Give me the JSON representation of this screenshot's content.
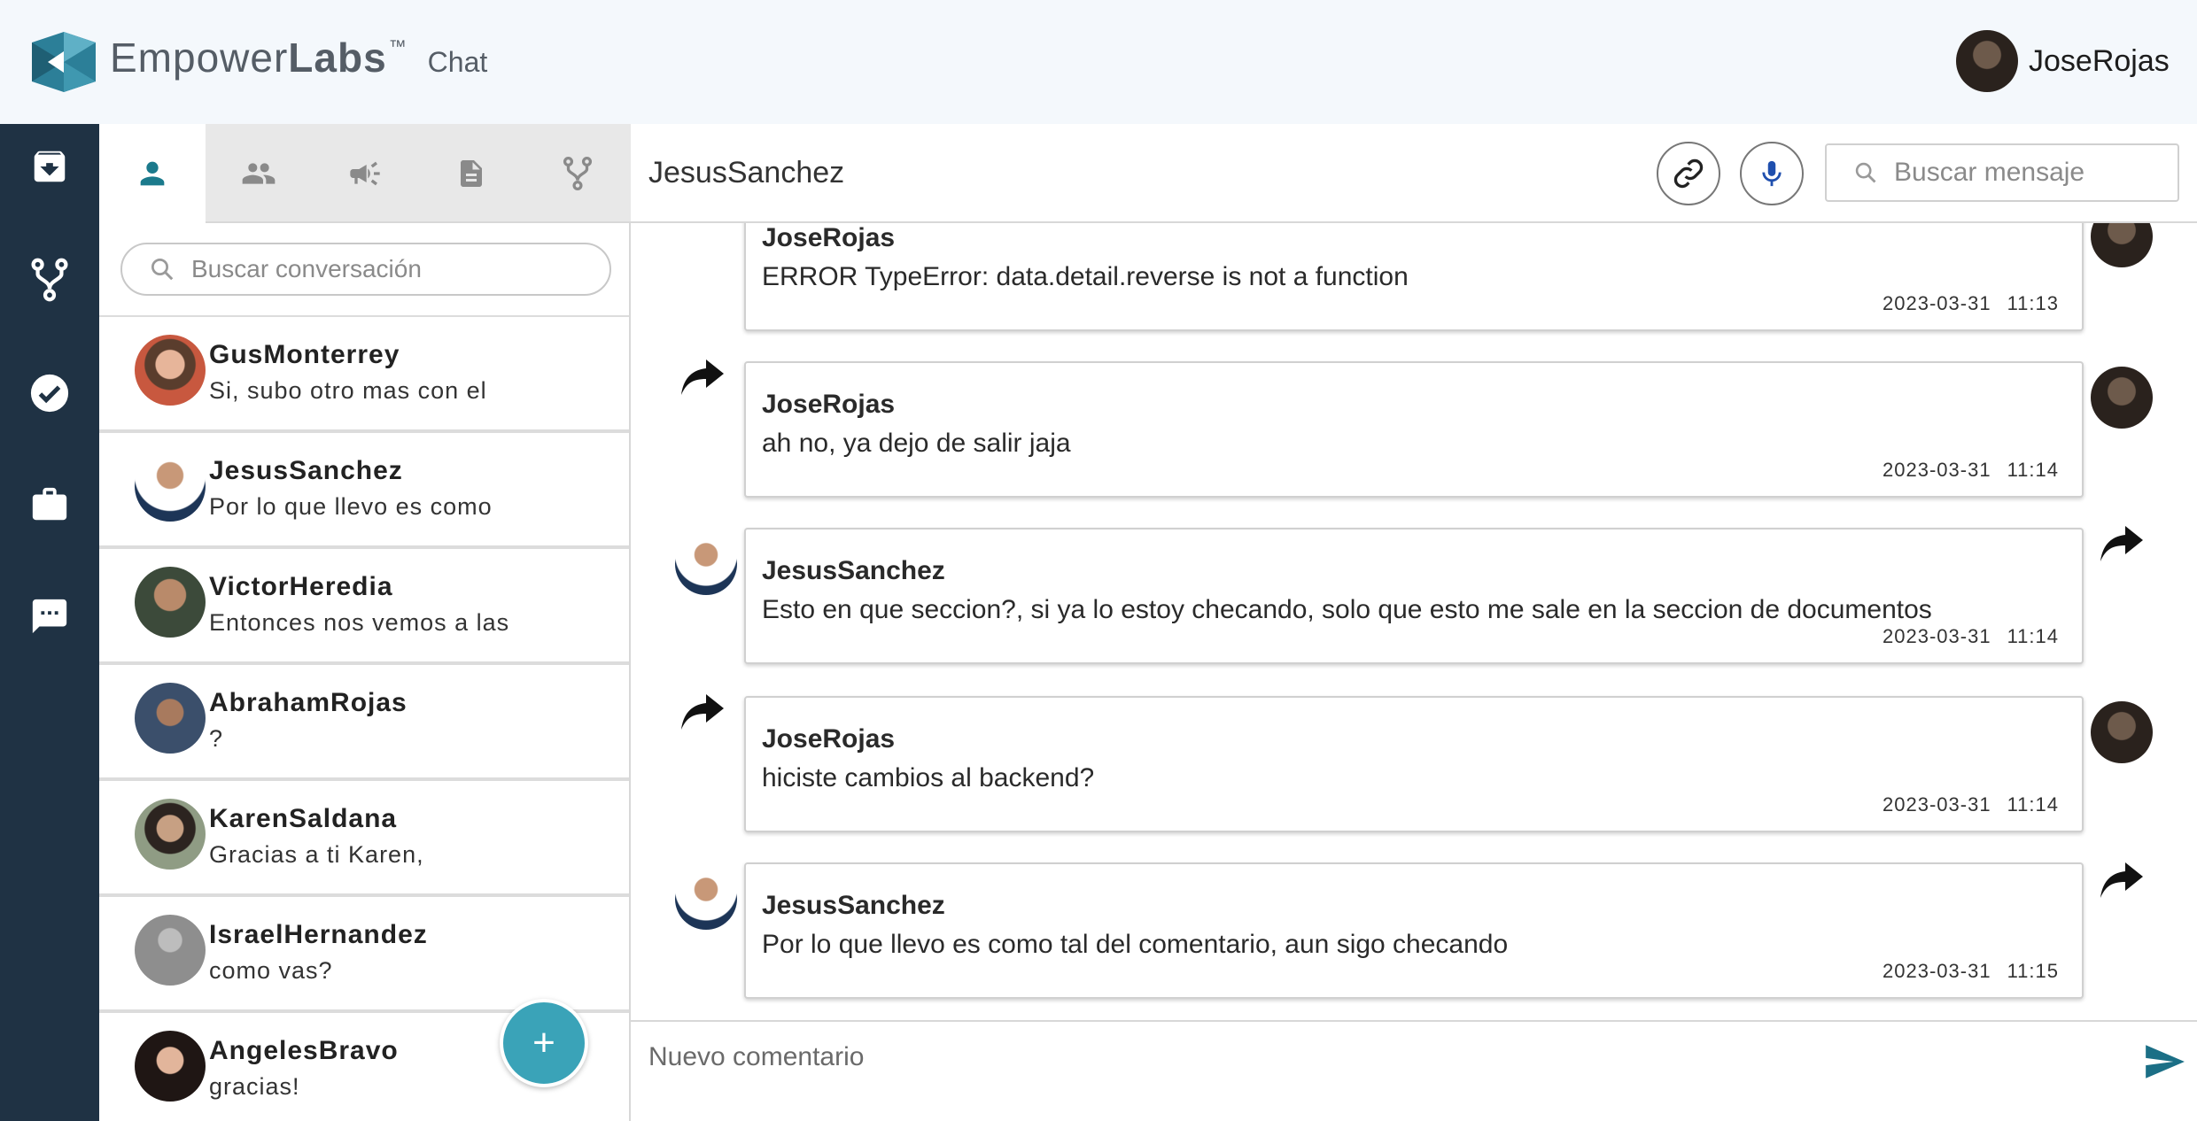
{
  "app": {
    "brand_first": "Empower",
    "brand_second": "Labs",
    "brand_tm": "™",
    "brand_suffix": "Chat",
    "accent_color": "#3aa3b8",
    "rail_color": "#1f3244"
  },
  "user": {
    "name": "JoseRojas"
  },
  "rail": {
    "items": [
      {
        "icon": "archive-download-icon"
      },
      {
        "icon": "fork-branch-icon"
      },
      {
        "icon": "check-circle-icon"
      },
      {
        "icon": "briefcase-icon"
      },
      {
        "icon": "chat-bubble-icon"
      }
    ]
  },
  "tabs": [
    {
      "icon": "person-icon",
      "active": true
    },
    {
      "icon": "group-icon",
      "active": false
    },
    {
      "icon": "megaphone-icon",
      "active": false
    },
    {
      "icon": "document-icon",
      "active": false
    },
    {
      "icon": "fork-branch-icon",
      "active": false
    }
  ],
  "conversations": {
    "search_placeholder": "Buscar conversación",
    "items": [
      {
        "name": "GusMonterrey",
        "last": "Si, subo otro mas con el"
      },
      {
        "name": "JesusSanchez",
        "last": "Por lo que llevo es como"
      },
      {
        "name": "VictorHeredia",
        "last": "Entonces nos vemos a las"
      },
      {
        "name": "AbrahamRojas",
        "last": "?"
      },
      {
        "name": "KarenSaldana",
        "last": "Gracias a ti Karen,"
      },
      {
        "name": "IsraelHernandez",
        "last": "como vas?"
      },
      {
        "name": "AngelesBravo",
        "last": "gracias!"
      }
    ],
    "fab_label": "+"
  },
  "chat": {
    "title": "JesusSanchez",
    "search_placeholder": "Buscar mensaje",
    "composer_placeholder": "Nuevo comentario",
    "messages": [
      {
        "author": "JoseRojas",
        "text": "ERROR TypeError: data.detail.reverse is not a function",
        "date": "2023-03-31",
        "time": "11:13"
      },
      {
        "author": "JoseRojas",
        "text": "ah no, ya dejo de salir jaja",
        "date": "2023-03-31",
        "time": "11:14"
      },
      {
        "author": "JesusSanchez",
        "text": "Esto en que seccion?, si ya lo estoy checando, solo que esto me sale en la seccion de documentos",
        "date": "2023-03-31",
        "time": "11:14"
      },
      {
        "author": "JoseRojas",
        "text": "hiciste cambios al backend?",
        "date": "2023-03-31",
        "time": "11:14"
      },
      {
        "author": "JesusSanchez",
        "text": "Por lo que llevo es como tal del comentario, aun sigo checando",
        "date": "2023-03-31",
        "time": "11:15"
      }
    ]
  }
}
